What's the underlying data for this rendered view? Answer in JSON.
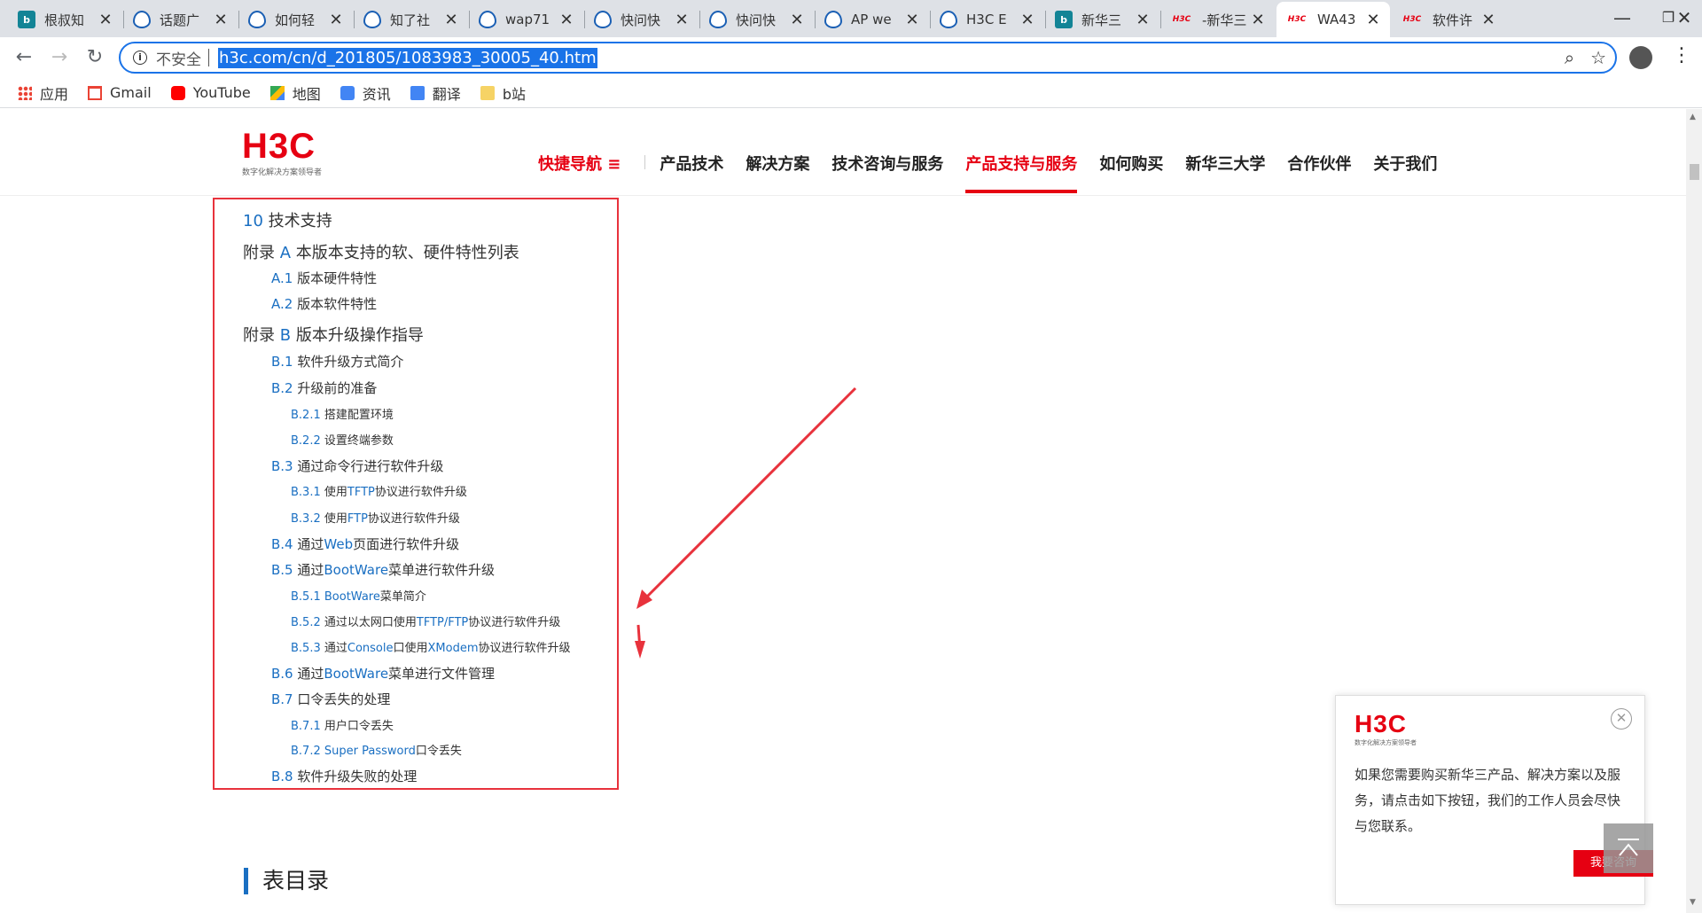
{
  "browser": {
    "tabs": [
      {
        "title": "根叔知",
        "icon": "bing"
      },
      {
        "title": "话题广",
        "icon": "drop"
      },
      {
        "title": "如何轻",
        "icon": "drop"
      },
      {
        "title": "知了社",
        "icon": "drop"
      },
      {
        "title": "wap71",
        "icon": "drop"
      },
      {
        "title": "快问快",
        "icon": "drop"
      },
      {
        "title": "快问快",
        "icon": "drop"
      },
      {
        "title": "AP we",
        "icon": "drop"
      },
      {
        "title": "H3C E",
        "icon": "drop"
      },
      {
        "title": "新华三",
        "icon": "bing"
      },
      {
        "title": "-新华三",
        "icon": "h3c"
      },
      {
        "title": "WA43",
        "icon": "h3c",
        "active": true
      },
      {
        "title": "软件许",
        "icon": "h3c"
      }
    ],
    "favicon_bing": "b",
    "favicon_h3c": "H3C",
    "tab_close": "✕",
    "new_tab": "+",
    "window_controls": {
      "minimize": "—",
      "maximize": "❐",
      "close": "✕"
    },
    "nav": {
      "back": "←",
      "forward": "→",
      "reload": "↻"
    },
    "security_icon": "i",
    "security_label": "不安全",
    "url": "h3c.com/cn/d_201805/1083983_30005_40.htm",
    "zoom_icon": "⌕",
    "star_icon": "☆",
    "menu_icon": "⋮",
    "bookmarks": [
      {
        "label": "应用",
        "icon": "apps"
      },
      {
        "label": "Gmail",
        "icon": "gmail"
      },
      {
        "label": "YouTube",
        "icon": "yt"
      },
      {
        "label": "地图",
        "icon": "map"
      },
      {
        "label": "资讯",
        "icon": "news"
      },
      {
        "label": "翻译",
        "icon": "trans"
      },
      {
        "label": "b站",
        "icon": "folder"
      }
    ]
  },
  "site": {
    "logo": "H3C",
    "logo_sub": "数字化解决方案领导者",
    "nav": [
      {
        "label": "快捷导航 ≡",
        "state": "quick"
      },
      {
        "label": "产品技术"
      },
      {
        "label": "解决方案"
      },
      {
        "label": "技术咨询与服务"
      },
      {
        "label": "产品支持与服务",
        "state": "active"
      },
      {
        "label": "如何购买"
      },
      {
        "label": "新华三大学"
      },
      {
        "label": "合作伙伴"
      },
      {
        "label": "关于我们"
      }
    ]
  },
  "toc": [
    {
      "num": "10",
      "text": " 技术支持",
      "level": 1
    },
    {
      "prefix": "附录 ",
      "num": "A",
      "text": " 本版本支持的软、硬件特性列表",
      "level": 1
    },
    {
      "num": "A.1",
      "text": " 版本硬件特性",
      "level": 2
    },
    {
      "num": "A.2",
      "text": " 版本软件特性",
      "level": 2
    },
    {
      "prefix": "附录 ",
      "num": "B",
      "text": " 版本升级操作指导",
      "level": 1
    },
    {
      "num": "B.1",
      "text": " 软件升级方式简介",
      "level": 2
    },
    {
      "num": "B.2",
      "text": " 升级前的准备",
      "level": 2
    },
    {
      "num": "B.2.1",
      "text": " 搭建配置环境",
      "level": 3
    },
    {
      "num": "B.2.2",
      "text": " 设置终端参数",
      "level": 3
    },
    {
      "num": "B.3",
      "text": " 通过命令行进行软件升级",
      "level": 2
    },
    {
      "num": "B.3.1",
      "text": " 使用",
      "blue": "TFTP",
      "tail": "协议进行软件升级",
      "level": 3
    },
    {
      "num": "B.3.2",
      "text": " 使用",
      "blue": "FTP",
      "tail": "协议进行软件升级",
      "level": 3
    },
    {
      "num": "B.4",
      "text": " 通过",
      "blue": "Web",
      "tail": "页面进行软件升级",
      "level": 2
    },
    {
      "num": "B.5",
      "text": " 通过",
      "blue": "BootWare",
      "tail": "菜单进行软件升级",
      "level": 2
    },
    {
      "num": "B.5.1",
      "text": " ",
      "blue": "BootWare",
      "tail": "菜单简介",
      "level": 3
    },
    {
      "num": "B.5.2",
      "text": " 通过以太网口使用",
      "blue": "TFTP/FTP",
      "tail": "协议进行软件升级",
      "level": 3
    },
    {
      "num": "B.5.3",
      "text": " 通过",
      "blue": "Console",
      "tail": "口使用",
      "blue2": "XModem",
      "tail2": "协议进行软件升级",
      "level": 3
    },
    {
      "num": "B.6",
      "text": " 通过",
      "blue": "BootWare",
      "tail": "菜单进行文件管理",
      "level": 2
    },
    {
      "num": "B.7",
      "text": " 口令丢失的处理",
      "level": 2
    },
    {
      "num": "B.7.1",
      "text": " 用户口令丢失",
      "level": 3
    },
    {
      "num": "B.7.2",
      "text": " ",
      "blue": "Super Password",
      "tail": "口令丢失",
      "level": 3
    },
    {
      "num": "B.8",
      "text": " 软件升级失败的处理",
      "level": 2
    }
  ],
  "section_title": "表目录",
  "popup": {
    "logo": "H3C",
    "logo_sub": "数字化解决方案领导者",
    "close": "✕",
    "text": "如果您需要购买新华三产品、解决方案以及服务，请点击如下按钮，我们的工作人员会尽快与您联系。",
    "button": "我要咨询"
  },
  "colors": {
    "brand_red": "#e60012",
    "link_blue": "#1a6fc2",
    "annotation_red": "#e8323c"
  }
}
